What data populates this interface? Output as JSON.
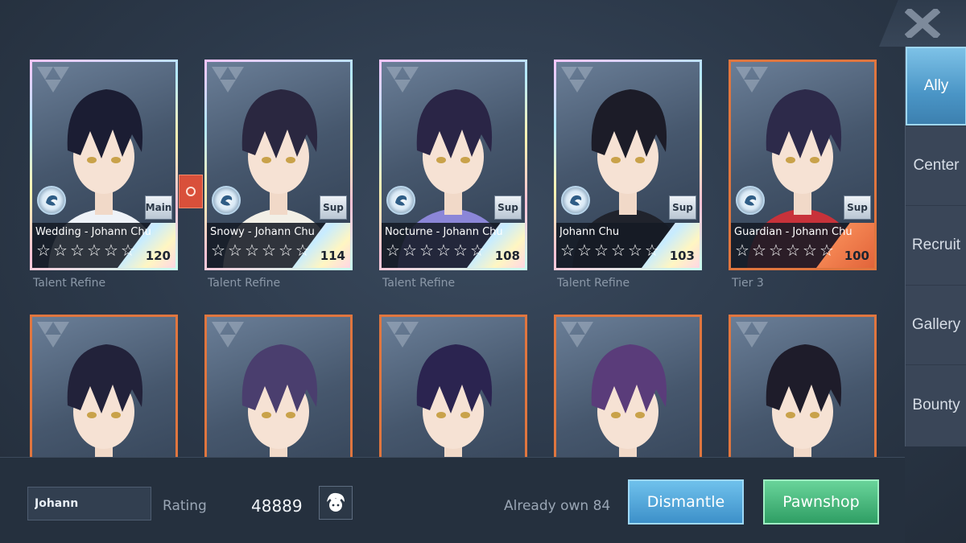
{
  "nav": {
    "tabs": [
      {
        "label": "Ally",
        "active": true
      },
      {
        "label": "Center",
        "active": false
      },
      {
        "label": "Recruit",
        "active": false
      },
      {
        "label": "Gallery",
        "active": false
      },
      {
        "label": "Bounty",
        "active": false
      }
    ],
    "close_icon": "close-x-icon"
  },
  "cards": [
    {
      "name": "Wedding - Johann Chu",
      "stars": 6,
      "level": "120",
      "role": "Main",
      "caption": "Talent Refine",
      "frame": "rainbow",
      "hair": "#1b1d33",
      "outfit": "#eef2f7"
    },
    {
      "name": "Snowy - Johann Chu",
      "stars": 6,
      "level": "114",
      "role": "Sup",
      "caption": "Talent Refine",
      "frame": "rainbow",
      "hair": "#2a2740",
      "outfit": "#f2efe6"
    },
    {
      "name": "Nocturne - Johann Chu",
      "stars": 6,
      "level": "108",
      "role": "Sup",
      "caption": "Talent Refine",
      "frame": "rainbow",
      "hair": "#2a2546",
      "outfit": "#8b86d8"
    },
    {
      "name": "Johann Chu",
      "stars": 6,
      "level": "103",
      "role": "Sup",
      "caption": "Talent Refine",
      "frame": "rainbow",
      "hair": "#1c1c28",
      "outfit": "#20232c"
    },
    {
      "name": "Guardian - Johann Chu",
      "stars": 6,
      "level": "100",
      "role": "Sup",
      "caption": "Tier 3",
      "frame": "orange",
      "hair": "#2d2a4a",
      "outfit": "#c8323a"
    },
    {
      "frame": "orange",
      "hair": "#22223a",
      "outfit": "#3a3f4a"
    },
    {
      "frame": "orange",
      "hair": "#4a3e6e",
      "outfit": "#1f2430"
    },
    {
      "frame": "orange",
      "hair": "#2b2450",
      "outfit": "#2b2a5a"
    },
    {
      "frame": "orange",
      "hair": "#5a3c7a",
      "outfit": "#f0d6e4"
    },
    {
      "frame": "orange",
      "hair": "#1e1c2a",
      "outfit": "#2b2e36"
    }
  ],
  "bottom": {
    "search_value": "Johann",
    "rating_label": "Rating",
    "rating_value": "48889",
    "owned_text": "Already own 84",
    "dismantle_label": "Dismantle",
    "pawnshop_label": "Pawnshop"
  },
  "colors": {
    "accent_blue": "#4a95c6",
    "accent_green": "#2f9e64",
    "frame_orange": "#e0763f"
  }
}
